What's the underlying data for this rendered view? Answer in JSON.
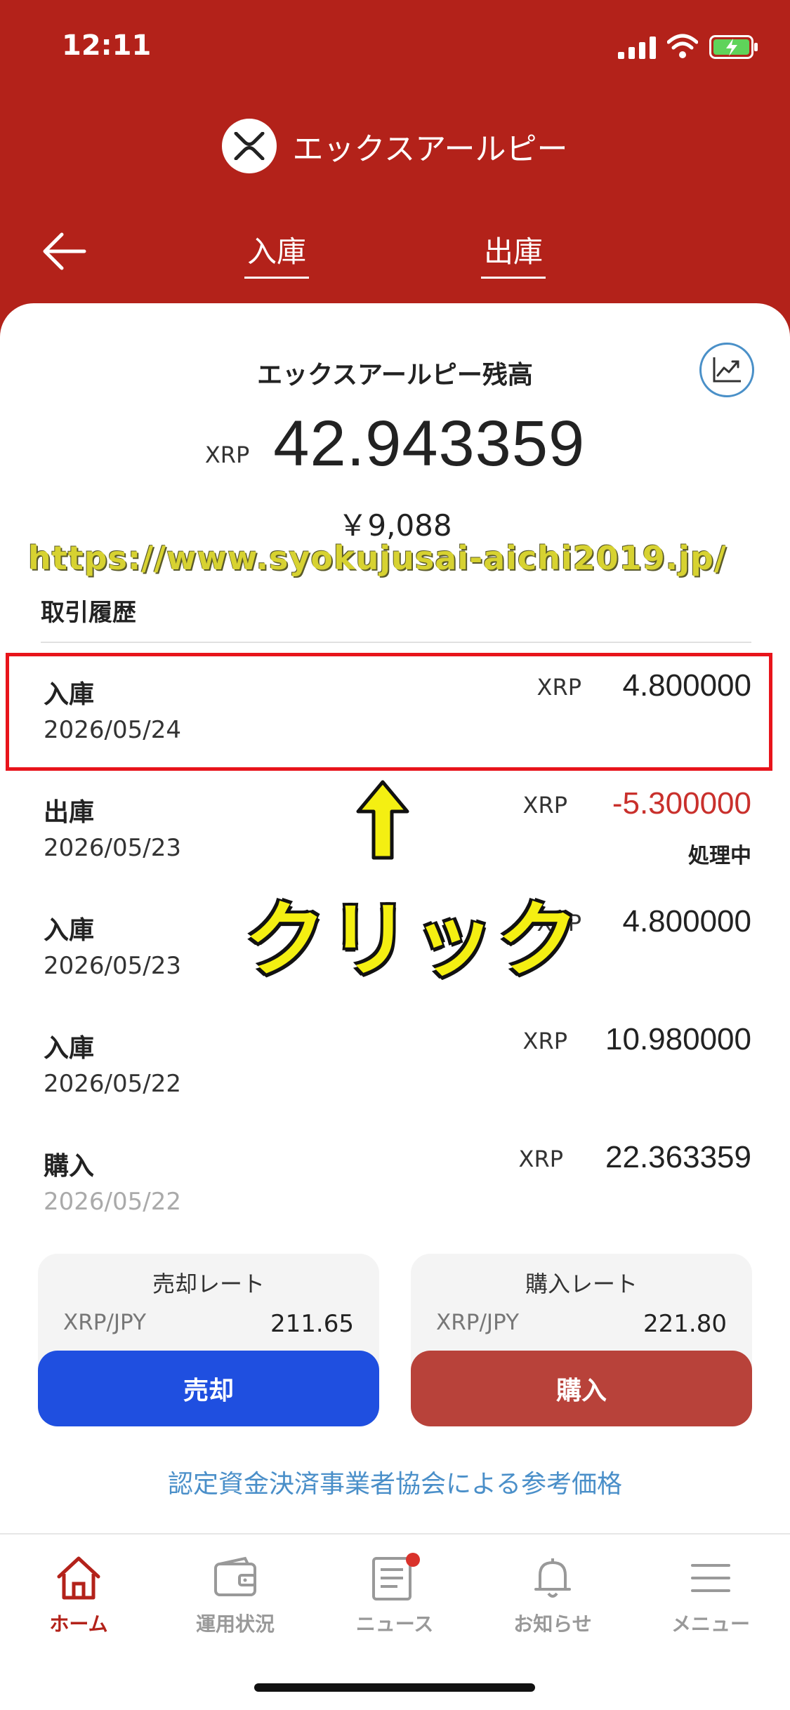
{
  "status_bar": {
    "time": "12:11"
  },
  "header": {
    "brand_title": "エックスアールピー",
    "tabs": [
      {
        "label": "入庫"
      },
      {
        "label": "出庫"
      }
    ]
  },
  "balance": {
    "label": "エックスアールピー残高",
    "unit": "XRP",
    "amount": "42.943359",
    "jpy": "￥9,088"
  },
  "watermark": "https://www.syokujusai-aichi2019.jp/",
  "history": {
    "title": "取引履歴",
    "items": [
      {
        "type": "入庫",
        "date": "2026/05/24",
        "unit": "XRP",
        "amount": "4.800000",
        "status": ""
      },
      {
        "type": "出庫",
        "date": "2026/05/23",
        "unit": "XRP",
        "amount": "-5.300000",
        "status": "処理中"
      },
      {
        "type": "入庫",
        "date": "2026/05/23",
        "unit": "XRP",
        "amount": "4.800000",
        "status": ""
      },
      {
        "type": "入庫",
        "date": "2026/05/22",
        "unit": "XRP",
        "amount": "10.980000",
        "status": ""
      },
      {
        "type": "購入",
        "date": "2026/05/22",
        "unit": "XRP",
        "amount": "22.363359",
        "status": ""
      }
    ]
  },
  "annotation": {
    "click_label": "クリック"
  },
  "rates": {
    "sell": {
      "title": "売却レート",
      "pair": "XRP/JPY",
      "value": "211.65",
      "button": "売却"
    },
    "buy": {
      "title": "購入レート",
      "pair": "XRP/JPY",
      "value": "221.80",
      "button": "購入"
    }
  },
  "reference_link": "認定資金決済事業者協会による参考価格",
  "bottom_nav": [
    {
      "label": "ホーム",
      "icon": "home-icon",
      "active": true
    },
    {
      "label": "運用状況",
      "icon": "wallet-icon",
      "active": false
    },
    {
      "label": "ニュース",
      "icon": "news-icon",
      "active": false
    },
    {
      "label": "お知らせ",
      "icon": "bell-icon",
      "active": false
    },
    {
      "label": "メニュー",
      "icon": "menu-icon",
      "active": false
    }
  ],
  "colors": {
    "header_bg": "#b3221a",
    "sell_button": "#1f4fe0",
    "buy_button": "#b8423a",
    "negative_amount": "#c9302c",
    "link": "#4a8fc9",
    "highlight_border": "#e8141b"
  }
}
